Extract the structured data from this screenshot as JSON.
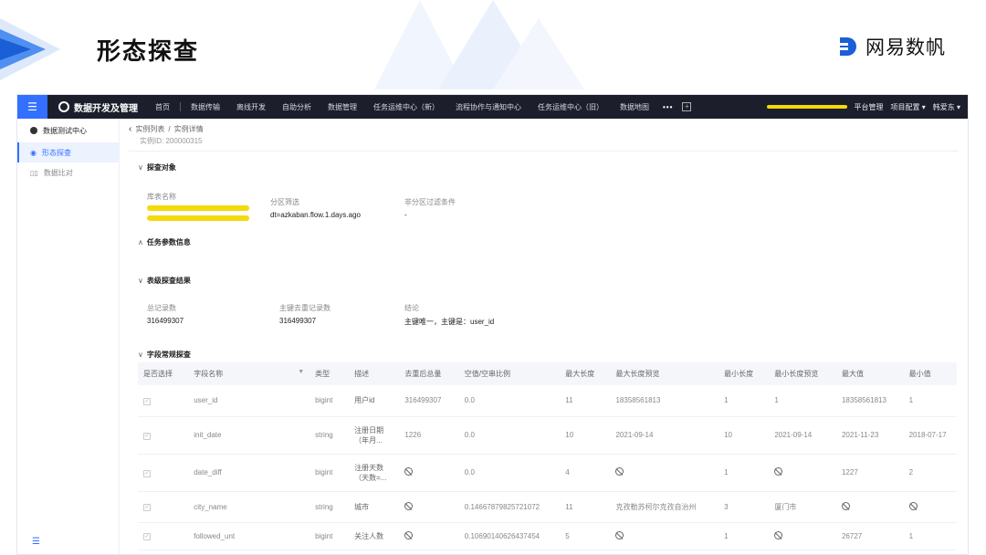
{
  "slide": {
    "title": "形态探查",
    "brand": "网易数帆"
  },
  "topnav": {
    "app_name": "数据开发及管理",
    "items": [
      "首页",
      "数据传输",
      "离线开发",
      "自助分析",
      "数据管理",
      "任务运维中心（新）",
      "流程协作与通知中心",
      "任务运维中心（旧）",
      "数据地图"
    ],
    "more": "•••",
    "plus": "+",
    "right_items": [
      "平台管理",
      "项目配置",
      "韩爱东"
    ]
  },
  "sidebar": {
    "group": "数据测试中心",
    "items": [
      {
        "label": "形态探查",
        "icon": "target-icon",
        "active": true
      },
      {
        "label": "数据比对",
        "icon": "compare-icon",
        "active": false
      }
    ],
    "collapse_icon": "☰"
  },
  "main": {
    "breadcrumb": [
      "实例列表",
      "实例详情"
    ],
    "breadcrumb_sep": "/",
    "instance_id": "实例ID: 200000315",
    "sections": {
      "target": "探查对象",
      "params": "任务参数信息",
      "table_result": "表级探查结果",
      "field_result": "字段常规探查"
    },
    "target": {
      "table_label": "库表名称",
      "partition_label": "分区筛选",
      "partition_value": "dt=azkaban.flow.1.days.ago",
      "nonpartition_label": "非分区过滤条件",
      "nonpartition_value": "-"
    },
    "table_result": {
      "total_label": "总记录数",
      "total_value": "316499307",
      "dedup_label": "主键去重记录数",
      "dedup_value": "316499307",
      "conclusion_label": "结论",
      "conclusion_value": "主键唯一，主键是：user_id"
    }
  },
  "field_table": {
    "columns": [
      "是否选择",
      "字段名称",
      "类型",
      "描述",
      "去重后总量",
      "空值/空串比例",
      "最大长度",
      "最大长度预览",
      "最小长度",
      "最小长度预览",
      "最大值",
      "最小值"
    ],
    "rows": [
      [
        "✓",
        "user_id",
        "bigint",
        "用户id",
        "316499307",
        "0.0",
        "11",
        "18358561813",
        "1",
        "1",
        "18358561813",
        "1"
      ],
      [
        "✓",
        "init_date",
        "string",
        "注册日期（年月...",
        "1226",
        "0.0",
        "10",
        "2021-09-14",
        "10",
        "2021-09-14",
        "2021-11-23",
        "2018-07-17"
      ],
      [
        "✓",
        "date_diff",
        "bigint",
        "注册天数（天数=...",
        "∅",
        "0.0",
        "4",
        "∅",
        "1",
        "∅",
        "1227",
        "2"
      ],
      [
        "✓",
        "city_name",
        "string",
        "城市",
        "∅",
        "0.14667879825721072",
        "11",
        "克孜勒苏柯尔克孜自治州",
        "3",
        "厦门市",
        "∅",
        "∅"
      ],
      [
        "✓",
        "followed_unt",
        "bigint",
        "关注人数",
        "∅",
        "0.10690140626437454",
        "5",
        "∅",
        "1",
        "∅",
        "26727",
        "1"
      ]
    ]
  },
  "colors": {
    "accent": "#3370ff",
    "nav_bg": "#1c1f2b",
    "highlight": "#f5d90a"
  }
}
